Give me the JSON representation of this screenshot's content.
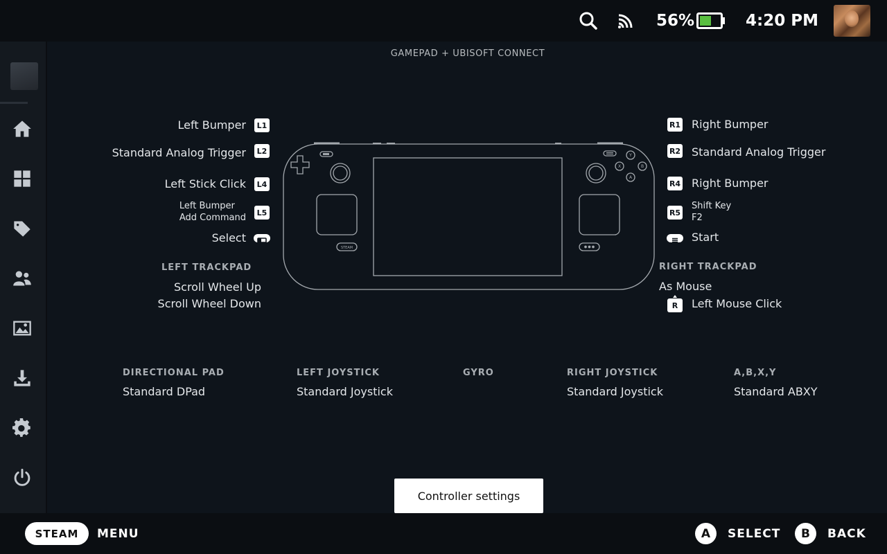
{
  "status_bar": {
    "battery": "56%",
    "time": "4:20 PM",
    "icons": [
      "search-icon",
      "wifi-icon",
      "battery-icon",
      "avatar"
    ]
  },
  "sidebar": {
    "items": [
      {
        "name": "home",
        "icon": "home-icon"
      },
      {
        "name": "library",
        "icon": "grid-icon"
      },
      {
        "name": "store",
        "icon": "tag-icon"
      },
      {
        "name": "friends",
        "icon": "friends-icon"
      },
      {
        "name": "media",
        "icon": "image-icon"
      },
      {
        "name": "downloads",
        "icon": "download-icon"
      },
      {
        "name": "settings",
        "icon": "gear-icon"
      },
      {
        "name": "power",
        "icon": "power-icon"
      }
    ]
  },
  "header": {
    "title": "GAMEPAD + UBISOFT CONNECT"
  },
  "left": {
    "l1": {
      "badge": "L1",
      "label": "Left Bumper"
    },
    "l2": {
      "badge": "L2",
      "label": "Standard Analog Trigger"
    },
    "l4": {
      "badge": "L4",
      "label": "Left Stick Click"
    },
    "l5": {
      "badge": "L5",
      "line1": "Left Bumper",
      "line2": "Add Command"
    },
    "select": {
      "label": "Select"
    },
    "trackpad": {
      "heading": "LEFT TRACKPAD",
      "line1": "Scroll Wheel Up",
      "line2": "Scroll Wheel Down"
    }
  },
  "right": {
    "r1": {
      "badge": "R1",
      "label": "Right Bumper"
    },
    "r2": {
      "badge": "R2",
      "label": "Standard Analog Trigger"
    },
    "r4": {
      "badge": "R4",
      "label": "Right Bumper"
    },
    "r5": {
      "badge": "R5",
      "line1": "Shift Key",
      "line2": "F2"
    },
    "start": {
      "label": "Start"
    },
    "trackpad": {
      "heading": "RIGHT TRACKPAD",
      "line1": "As Mouse",
      "click_badge": "R",
      "click_label": "Left Mouse Click"
    }
  },
  "bottom_groups": [
    {
      "heading": "DIRECTIONAL PAD",
      "value": "Standard DPad"
    },
    {
      "heading": "LEFT JOYSTICK",
      "value": "Standard Joystick"
    },
    {
      "heading": "GYRO",
      "value": ""
    },
    {
      "heading": "RIGHT JOYSTICK",
      "value": "Standard Joystick"
    },
    {
      "heading": "A,B,X,Y",
      "value": "Standard ABXY"
    }
  ],
  "controller_settings_button": "Controller settings",
  "footer": {
    "steam": "STEAM",
    "menu": "MENU",
    "a_glyph": "A",
    "select": "SELECT",
    "b_glyph": "B",
    "back": "BACK"
  },
  "colors": {
    "background": "#0e141b",
    "topbar": "#0b0e12",
    "sidebar": "#14191f",
    "battery_fill": "#59bf40",
    "text": "#e4e7ea"
  }
}
